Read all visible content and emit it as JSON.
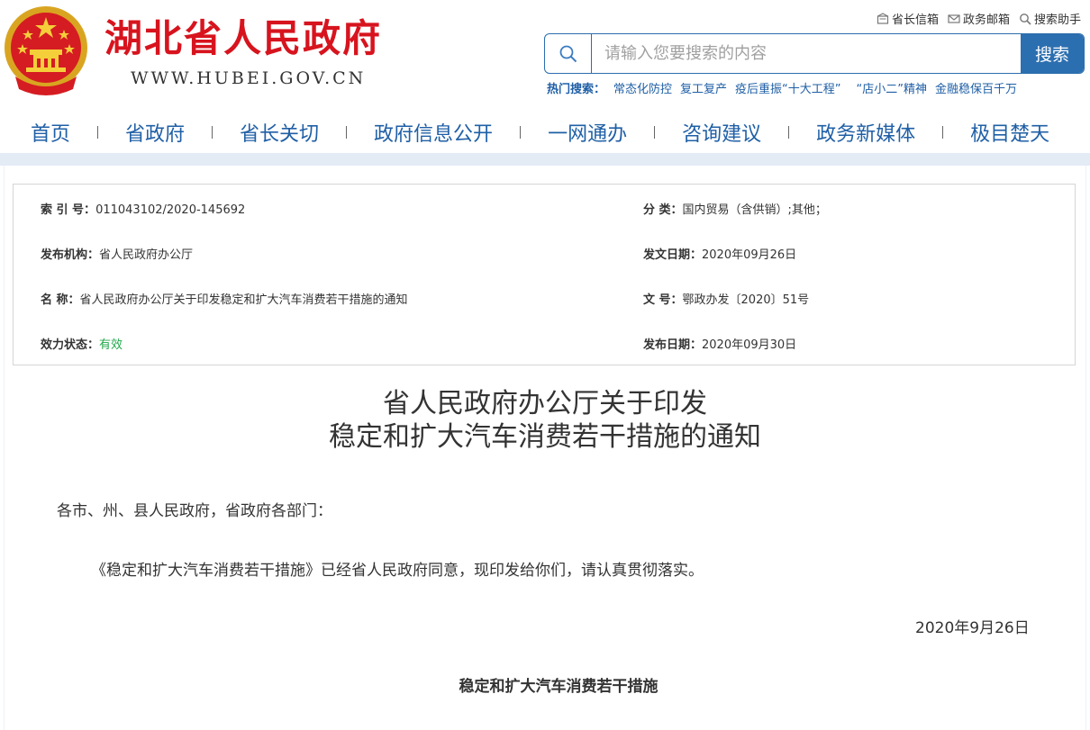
{
  "header": {
    "site_name": "湖北省人民政府",
    "site_url": "WWW.HUBEI.GOV.CN",
    "top_links": [
      {
        "label": "省长信箱",
        "icon": "mailbox-icon"
      },
      {
        "label": "政务邮箱",
        "icon": "envelope-icon"
      },
      {
        "label": "搜索助手",
        "icon": "search-icon"
      }
    ],
    "search": {
      "placeholder": "请输入您要搜索的内容",
      "button_label": "搜索"
    },
    "hot_search": {
      "label": "热门搜索：",
      "items": [
        "常态化防控",
        "复工复产",
        "疫后重振“十大工程”",
        "“店小二”精神",
        "金融稳保百千万"
      ]
    }
  },
  "nav": {
    "items": [
      "首页",
      "省政府",
      "省长关切",
      "政府信息公开",
      "一网通办",
      "咨询建议",
      "政务新媒体",
      "极目楚天"
    ]
  },
  "meta": {
    "index_no_key": "索 引 号：",
    "index_no": "011043102/2020-145692",
    "category_key": "分 类：",
    "category": "国内贸易（含供销）;其他；",
    "issuer_key": "发布机构：",
    "issuer": "省人民政府办公厅",
    "doc_date_key": "发文日期：",
    "doc_date": "2020年09月26日",
    "name_key": "名 称：",
    "name": "省人民政府办公厅关于印发稳定和扩大汽车消费若干措施的通知",
    "doc_no_key": "文 号：",
    "doc_no": "鄂政办发〔2020〕51号",
    "status_key": "效力状态：",
    "status": "有效",
    "publish_date_key": "发布日期：",
    "publish_date": "2020年09月30日"
  },
  "article": {
    "title_line1": "省人民政府办公厅关于印发",
    "title_line2": "稳定和扩大汽车消费若干措施的通知",
    "salutation": "各市、州、县人民政府，省政府各部门：",
    "body": "《稳定和扩大汽车消费若干措施》已经省人民政府同意，现印发给你们，请认真贯彻落实。",
    "date": "2020年9月26日",
    "subtitle": "稳定和扩大汽车消费若干措施"
  },
  "colors": {
    "brand_red": "#d7141e",
    "nav_blue": "#1f5fa6",
    "button_blue": "#2c6fb0",
    "status_green": "#21a84a"
  }
}
